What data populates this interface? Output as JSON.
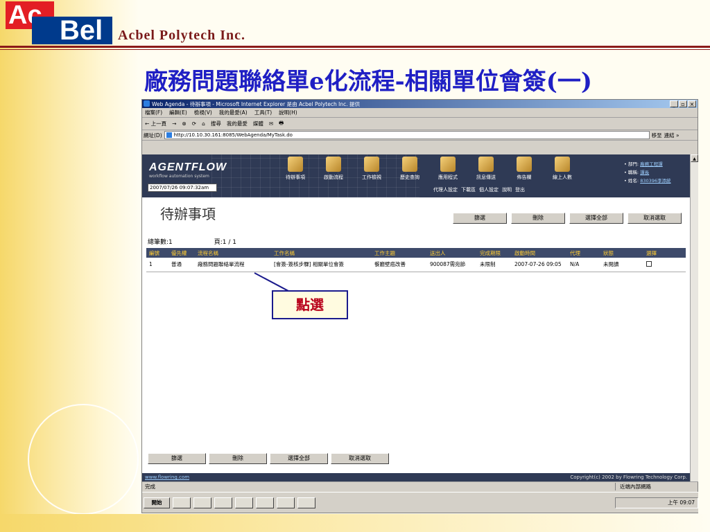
{
  "slide": {
    "company": "Acbel Polytech Inc.",
    "logo_top": "Ac",
    "logo_bottom": "Bel",
    "title": "廠務問題聯絡單e化流程-相關單位會簽(一)"
  },
  "browser": {
    "title": "Web Agenda - 待辦事項 - Microsoft Internet Explorer 是由 Acbel Polytech Inc. 提供",
    "menu": [
      "檔案(F)",
      "編輯(E)",
      "檢視(V)",
      "我的最愛(A)",
      "工具(T)",
      "說明(H)"
    ],
    "toolbar": [
      "← 上一頁",
      "→",
      "⊗",
      "⟳",
      "⌂",
      "搜尋",
      "我的最愛",
      "媒體",
      "✉",
      "🖶"
    ],
    "address_label": "網址(D)",
    "address": "http://10.10.30.161:8085/WebAgenda/MyTask.do",
    "go": "移至",
    "links": "連結 »",
    "status": "完成",
    "zone": "近端內部網路"
  },
  "app": {
    "brand": "AGENTFLOW",
    "brand_sub": "workflow automation system",
    "datetime": "2007/07/26 09:07:32am",
    "nav": [
      "待辦事項",
      "啟動流程",
      "工作檢視",
      "歷史查詢",
      "應用程式",
      "訊息傳送",
      "佈告欄",
      "線上人數"
    ],
    "subnav": [
      "代理人設定",
      "下載區",
      "個人設定",
      "說明",
      "登出"
    ],
    "user": {
      "dept_label": "部門:",
      "dept": "廠務工程課",
      "title_label": "職稱:",
      "title": "課長",
      "name_label": "姓名:",
      "name": "830396李添統"
    },
    "page_title": "待辦事項",
    "actions": [
      "篩選",
      "刪除",
      "選擇全部",
      "取消選取"
    ],
    "total": "總筆數:1",
    "page": "頁:1 / 1",
    "columns": [
      "編號",
      "優先權",
      "流程名稱",
      "工作名稱",
      "工作主題",
      "送出人",
      "完成期限",
      "啟動時間",
      "代理",
      "狀態",
      "選擇"
    ],
    "rows": [
      [
        "1",
        "普通",
        "廠務問題聯絡單流程",
        "[會簽-簽核步驟] 相關單位會簽",
        "餐廳壁癌改善",
        "900087需宛節",
        "未限制",
        "2007-07-26 09:05",
        "N/A",
        "未閱讀",
        ""
      ]
    ],
    "callout": "點選",
    "footer_link": "www.flowring.com",
    "copyright": "Copyright(c) 2002 by Flowring Technology Corp."
  },
  "taskbar": {
    "start": "開始",
    "clock": "上午 09:07"
  }
}
